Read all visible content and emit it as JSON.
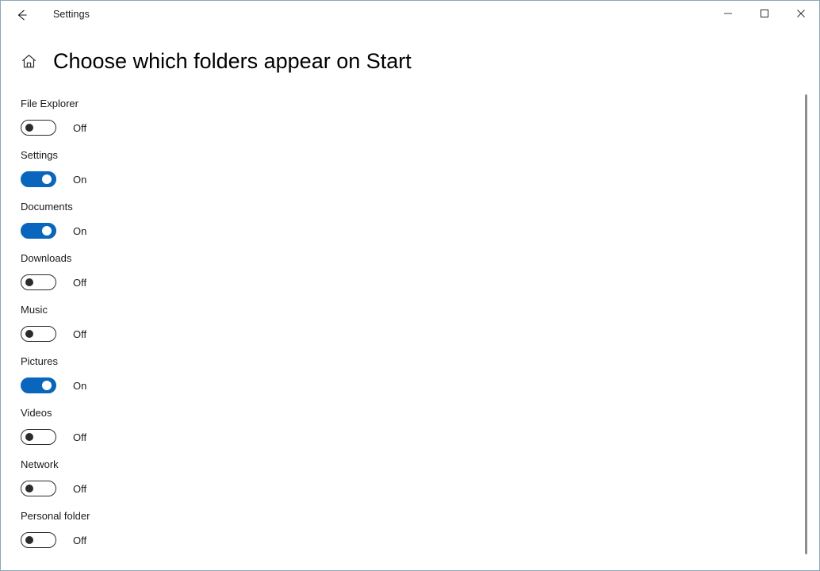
{
  "window": {
    "app_title": "Settings",
    "back_icon": "back-arrow-icon",
    "minimize_label": "Minimize",
    "maximize_label": "Maximize",
    "close_label": "Close",
    "border_color": "#8aa8b8"
  },
  "header": {
    "home_icon": "home-icon",
    "title": "Choose which folders appear on Start"
  },
  "accent_color": "#0a65bd",
  "settings": [
    {
      "label": "File Explorer",
      "state": "Off",
      "on": false
    },
    {
      "label": "Settings",
      "state": "On",
      "on": true
    },
    {
      "label": "Documents",
      "state": "On",
      "on": true
    },
    {
      "label": "Downloads",
      "state": "Off",
      "on": false
    },
    {
      "label": "Music",
      "state": "Off",
      "on": false
    },
    {
      "label": "Pictures",
      "state": "On",
      "on": true
    },
    {
      "label": "Videos",
      "state": "Off",
      "on": false
    },
    {
      "label": "Network",
      "state": "Off",
      "on": false
    },
    {
      "label": "Personal folder",
      "state": "Off",
      "on": false
    }
  ],
  "scrollbar": {
    "name": "vertical-scrollbar"
  }
}
